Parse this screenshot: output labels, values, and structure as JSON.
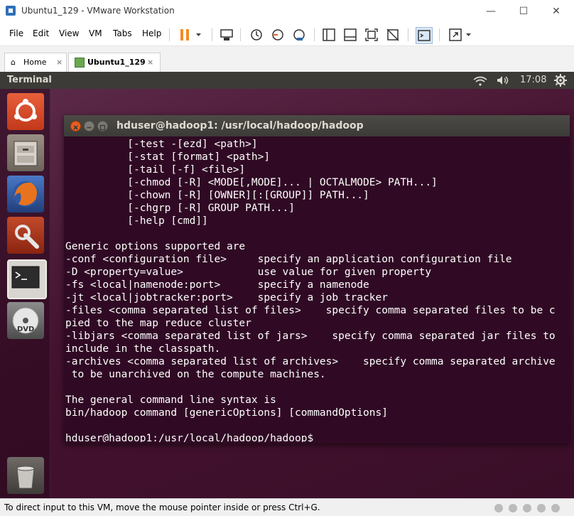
{
  "window": {
    "title": "Ubuntu1_129 - VMware Workstation",
    "minimize": "—",
    "maximize": "☐",
    "close": "✕"
  },
  "menu": {
    "items": [
      "File",
      "Edit",
      "View",
      "VM",
      "Tabs",
      "Help"
    ]
  },
  "tabs": [
    {
      "label": "Home",
      "close": "×"
    },
    {
      "label": "Ubuntu1_129",
      "close": "×"
    }
  ],
  "panel": {
    "title": "Terminal",
    "clock": "17:08"
  },
  "terminal": {
    "title": "hduser@hadoop1: /usr/local/hadoop/hadoop",
    "lines": [
      "          [-test -[ezd] <path>]",
      "          [-stat [format] <path>]",
      "          [-tail [-f] <file>]",
      "          [-chmod [-R] <MODE[,MODE]... | OCTALMODE> PATH...]",
      "          [-chown [-R] [OWNER][:[GROUP]] PATH...]",
      "          [-chgrp [-R] GROUP PATH...]",
      "          [-help [cmd]]",
      "",
      "Generic options supported are",
      "-conf <configuration file>     specify an application configuration file",
      "-D <property=value>            use value for given property",
      "-fs <local|namenode:port>      specify a namenode",
      "-jt <local|jobtracker:port>    specify a job tracker",
      "-files <comma separated list of files>    specify comma separated files to be c",
      "pied to the map reduce cluster",
      "-libjars <comma separated list of jars>    specify comma separated jar files to",
      "include in the classpath.",
      "-archives <comma separated list of archives>    specify comma separated archive",
      " to be unarchived on the compute machines.",
      "",
      "The general command line syntax is",
      "bin/hadoop command [genericOptions] [commandOptions]",
      "",
      "hduser@hadoop1:/usr/local/hadoop/hadoop$"
    ]
  },
  "status": {
    "text": "To direct input to this VM, move the mouse pointer inside or press Ctrl+G."
  },
  "colors": {
    "terminal_bg": "#300a24",
    "panel_bg": "#3c3b37",
    "pause_orange": "#f28c28",
    "close_orange": "#e85e1d"
  }
}
